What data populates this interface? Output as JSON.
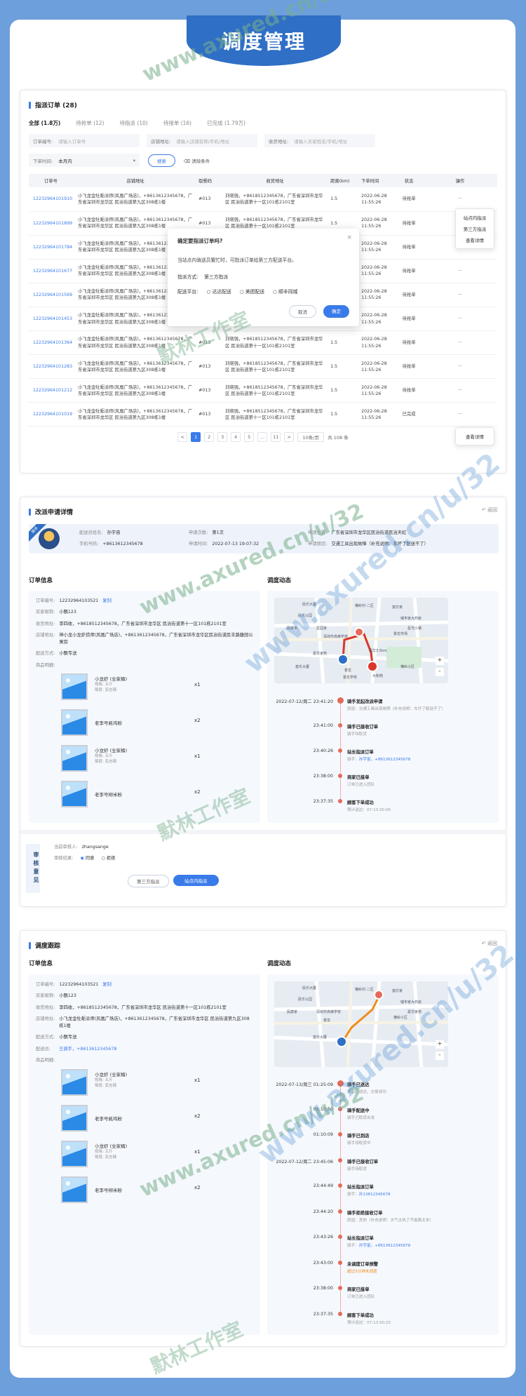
{
  "page_title": "调度管理",
  "orders": {
    "title": "指派订单 (28)",
    "tabs": [
      "全部 (1.8万)",
      "待抢单 (12)",
      "待指派 (10)",
      "待接单 (16)",
      "已完成 (1.79万)"
    ],
    "filters": [
      {
        "label": "订单编号:",
        "placeholder": "请输入订单号"
      },
      {
        "label": "店铺地址:",
        "placeholder": "请输入店铺名称/手机/地址"
      },
      {
        "label": "收货地址:",
        "placeholder": "请输入买家姓名/手机/地址"
      }
    ],
    "time_label": "下单时间:",
    "time_value": "本月内",
    "search_label": "搜索",
    "clear_label": "清除条件",
    "headers": [
      "订单号",
      "店铺地址",
      "取餐码",
      "收货地址",
      "距离(km)",
      "下单时间",
      "状态",
      "操作"
    ],
    "rows": [
      {
        "id": "12232964101910",
        "shop": "小飞龙金牡蛎派师(风凰广场店)，+8613612345678，广东省深圳市龙华区 民治街道第九区308栋1楼",
        "code": "#013",
        "addr": "刘晓强，+8618512345678，广东省深圳市龙华区 民治街道第十一区101栋2101室",
        "dist": "1.5",
        "time": "2022-06-28 11:55:26",
        "status": "待抢单",
        "op": "···"
      },
      {
        "id": "12232964101899",
        "shop": "小飞龙金牡蛎派师(风凰广场店)，+8613612345678，广东省深圳市龙华区 民治街道第九区308栋1楼",
        "code": "#013",
        "addr": "刘晓强，+8618512345678，广东省深圳市龙华区 民治街道第十一区101栋2101室",
        "dist": "1.5",
        "time": "2022-06-28 11:55:26",
        "status": "待抢单",
        "op": "···"
      },
      {
        "id": "12232964101784",
        "shop": "小飞龙金牡蛎派师(风凰广场店)，+8613612345678，广东省深圳市龙华区 民治街道第九区308栋1楼",
        "code": "#013",
        "addr": "刘晓强，+8618512345678，广东省深圳市龙华区 民治街道第十一区101栋2101室",
        "dist": "1.5",
        "time": "2022-06-28 11:55:26",
        "status": "待抢单",
        "op": "···"
      },
      {
        "id": "12232964101677",
        "shop": "小飞龙金牡蛎派师(风凰广场店)，+8613612345678，广东省深圳市龙华区 民治街道第九区308栋1楼",
        "code": "#013",
        "addr": "刘晓强，+8618512345678，广东省深圳市龙华区 民治街道第十一区101栋2101室",
        "dist": "1.5",
        "time": "2022-06-28 11:55:26",
        "status": "待抢单",
        "op": "···"
      },
      {
        "id": "12232964101569",
        "shop": "小飞龙金牡蛎派师(风凰广场店)，+8613612345678，广东省深圳市龙华区 民治街道第九区308栋1楼",
        "code": "#013",
        "addr": "刘晓强，+8618512345678，广东省深圳市龙华区 民治街道第十一区101栋2101室",
        "dist": "1.5",
        "time": "2022-06-28 11:55:26",
        "status": "待抢单",
        "op": "···"
      },
      {
        "id": "12232964101453",
        "shop": "小飞龙金牡蛎派师(风凰广场店)，+8613612345678，广东省深圳市龙华区 民治街道第九区308栋1楼",
        "code": "#013",
        "addr": "刘晓强，+8618512345678，广东省深圳市龙华区 民治街道第十一区101栋2101室",
        "dist": "1.5",
        "time": "2022-06-28 11:55:26",
        "status": "待抢单",
        "op": "···"
      },
      {
        "id": "12232964101364",
        "shop": "小飞龙金牡蛎派师(风凰广场店)，+8613612345678，广东省深圳市龙华区 民治街道第九区308栋1楼",
        "code": "#013",
        "addr": "刘晓强，+8618512345678，广东省深圳市龙华区 民治街道第十一区101栋2101室",
        "dist": "1.5",
        "time": "2022-06-28 11:55:26",
        "status": "待抢单",
        "op": "···"
      },
      {
        "id": "12232964101283",
        "shop": "小飞龙金牡蛎派师(风凰广场店)，+8613612345678，广东省深圳市龙华区 民治街道第九区308栋1楼",
        "code": "#013",
        "addr": "刘晓强，+8618512345678，广东省深圳市龙华区 民治街道第十一区101栋2101室",
        "dist": "1.5",
        "time": "2022-06-28 11:55:26",
        "status": "待抢单",
        "op": "···"
      },
      {
        "id": "12232964101212",
        "shop": "小飞龙金牡蛎派师(风凰广场店)，+8613612345678，广东省深圳市龙华区 民治街道第九区308栋1楼",
        "code": "#013",
        "addr": "刘晓强，+8618512345678，广东省深圳市龙华区 民治街道第十一区101栋2101室",
        "dist": "1.5",
        "time": "2022-06-28 11:55:26",
        "status": "待抢单",
        "op": "···"
      },
      {
        "id": "12232964101019",
        "shop": "小飞龙金牡蛎派师(风凰广场店)，+8613612345678，广东省深圳市龙华区 民治街道第九区308栋1楼",
        "code": "#013",
        "addr": "刘晓强，+8618512345678，广东省深圳市龙华区 民治街道第十一区101栋2101室",
        "dist": "1.5",
        "time": "2022-06-28 11:55:26",
        "status": "已完成",
        "op": "···"
      }
    ],
    "menu": [
      "站点内指派",
      "第三方指派",
      "查看详情"
    ],
    "menu2": "查看详情",
    "pages": [
      "<",
      "1",
      "2",
      "3",
      "4",
      "5",
      "...",
      "11",
      ">"
    ],
    "page_size": "10条/页",
    "total": "共 108 条",
    "modal": {
      "title": "确定要指派订单吗?",
      "desc": "当站点内骑送员繁忙时，可指派订单给第三方配送平台。",
      "way_label": "指派方式:",
      "way_value": "第三方指派",
      "plat_label": "配送平台:",
      "plats": [
        "达达配送",
        "美团配送",
        "顺丰同城"
      ],
      "cancel": "取消",
      "ok": "确定"
    }
  },
  "change": {
    "title": "改派申请详情",
    "back": "返回",
    "badge": "骑手",
    "rider_label": "配送员姓名:",
    "rider": "孙宇宙",
    "phone_label": "手机号码:",
    "phone": "+8613612345678",
    "count_label": "申请次数:",
    "count": "第1次",
    "time_label": "申请时间:",
    "time": "2022-07-13 19:07:32",
    "pos_label": "申请位置:",
    "pos": "广东省深圳市龙华区民治街道民治天虹",
    "reason_label": "申请原因:",
    "reason": "交通工具出现故障（补充说明：车坏了配送不了）",
    "order_title": "订单信息",
    "dyn_title": "调度动态",
    "order": [
      {
        "k": "订单编号:",
        "v": "12232964103521",
        "link": "复制"
      },
      {
        "k": "买家昵称:",
        "v": "小飘123"
      },
      {
        "k": "收货地址:",
        "v": "李四收，+8618512345678，广东省深圳市龙华区 民治街道第十一区101栋2101室"
      },
      {
        "k": "店铺地址:",
        "v": "神小龙小龙虾捞师(凤凰广场店)，+8613612345678，广东省深圳市龙华区民治街道民丰路馥园公寓旁"
      },
      {
        "k": "配送方式:",
        "v": "小飘专送"
      },
      {
        "k": "商品明细:",
        "v": ""
      }
    ],
    "goods": [
      {
        "name": "小龙虾 (全家桶)",
        "spec": "规格: 五斤",
        "flavor": "辣度: 变态辣",
        "qty": "x1"
      },
      {
        "name": "老李号蚝鸡粉",
        "spec": "",
        "flavor": "",
        "qty": "x2"
      },
      {
        "name": "小龙虾 (全家桶)",
        "spec": "规格: 五斤",
        "flavor": "辣度: 变态辣",
        "qty": "x1"
      },
      {
        "name": "老李号柳米粉",
        "spec": "",
        "flavor": "",
        "qty": "x2"
      }
    ],
    "timeline": [
      {
        "time": "2022-07-12/周二 23:41:20",
        "title": "骑手发起改派申请",
        "desc": "原因：交通工具出现故障（补充说明：车坏了配送不了）",
        "hl": true
      },
      {
        "time": "23:41:00",
        "title": "骑手已接收订单",
        "desc": "骑手待取货"
      },
      {
        "time": "23:40:26",
        "title": "站长指派订单",
        "desc": "骑手：",
        "link": "孙宇宙，+8613612345678"
      },
      {
        "time": "23:38:00",
        "title": "商家已接单",
        "desc": "订单已进入团队"
      },
      {
        "time": "23:37:35",
        "title": "顾客下单成功",
        "desc": "预计送达：07-13 00:05"
      }
    ],
    "map_labels": [
      "民乐大厦",
      "横岭村-二区",
      "富乐家",
      "民乐公园",
      "瑞丰家大药房",
      "星光小镇",
      "民康家",
      "星园家",
      "深圳市高峰学校",
      "嘉华家苑",
      "景龙市场",
      "景龙",
      "景龙学校",
      "嘉华3.5km",
      "富乐大厦",
      "横岭小区",
      "大和苑"
    ],
    "audit_title": "审核意见",
    "auditor_label": "当前审核人:",
    "auditor": "zhangsange",
    "result_label": "审核结果:",
    "opts": [
      "同意",
      "拒绝"
    ],
    "btn_third": "第三方指派",
    "btn_site": "站点内指派"
  },
  "trace": {
    "title": "调度跟踪",
    "back": "返回",
    "order_title": "订单信息",
    "dyn_title": "调度动态",
    "order": [
      {
        "k": "订单编号:",
        "v": "12232964103521",
        "link": "复制"
      },
      {
        "k": "买家昵称:",
        "v": "小飘123"
      },
      {
        "k": "收货地址:",
        "v": "李四收，+8618512345678，广东省深圳市龙华区 民治街道第十一区101栋2101室"
      },
      {
        "k": "店铺地址:",
        "v": "小飞龙金牡蛎派师(风凰广场店)，+8613612345678，广东省深圳市龙华区 民治街道第九区308栋1楼"
      },
      {
        "k": "配送方式:",
        "v": "小飘专送"
      },
      {
        "k": "配送员:",
        "v": "",
        "link": "王骑手，+8613612345678"
      },
      {
        "k": "商品明细:",
        "v": ""
      }
    ],
    "goods": [
      {
        "name": "小龙虾 (全家桶)",
        "spec": "规格: 五斤",
        "flavor": "辣度: 变态辣",
        "qty": "x1"
      },
      {
        "name": "老李号蚝鸡粉",
        "spec": "",
        "flavor": "",
        "qty": "x2"
      },
      {
        "name": "小龙虾 (全家桶)",
        "spec": "规格: 五斤",
        "flavor": "辣度: 变态辣",
        "qty": "x1"
      },
      {
        "name": "老李号柳米粉",
        "spec": "",
        "flavor": "",
        "qty": "x2"
      }
    ],
    "timeline": [
      {
        "time": "2022-07-13/周三 01:25:09",
        "title": "骑手已送达",
        "desc": "商品已送达，交易成功",
        "hl": true
      },
      {
        "time": "01:10:50",
        "title": "骑手配送中",
        "desc": "骑手已取货出发"
      },
      {
        "time": "01:10:09",
        "title": "骑手已到店",
        "desc": "骑手待取货中"
      },
      {
        "time": "2022-07-12/周二 23:45:06",
        "title": "骑手已接收订单",
        "desc": "骑手待取货"
      },
      {
        "time": "23:44:49",
        "title": "站长指派订单",
        "desc": "骑手：",
        "link": "孙13812345678"
      },
      {
        "time": "23:44:20",
        "title": "骑手拒绝接收订单",
        "desc": "原因：其他（补充说明：天气太热了不能跑太多）"
      },
      {
        "time": "23:43:26",
        "title": "站长指派订单",
        "desc": "骑手：",
        "link": "孙宇宙，+8613612345678"
      },
      {
        "time": "23:43:00",
        "title": "未调度订单预警",
        "desc": "",
        "warn": "超过5分钟未调度"
      },
      {
        "time": "23:38:00",
        "title": "商家已接单",
        "desc": "订单已进入团队"
      },
      {
        "time": "23:37:35",
        "title": "顾客下单成功",
        "desc": "预计送达：07-13 00:25"
      }
    ],
    "map_labels": [
      "民乐大厦",
      "横岭村-二区",
      "富乐家",
      "民乐公园",
      "瑞丰家大药房",
      "嘉华家苑",
      "民康家",
      "深圳市高峰学校",
      "景龙",
      "富乐大厦",
      "横岭小区"
    ]
  },
  "watermarks": [
    "www.axured.cn/u/32",
    "默林工作室"
  ],
  "colors": {
    "primary": "#3a7bea",
    "background": "#6d9fdc",
    "banner": "#2f6fc5",
    "danger": "#e56a5a"
  }
}
